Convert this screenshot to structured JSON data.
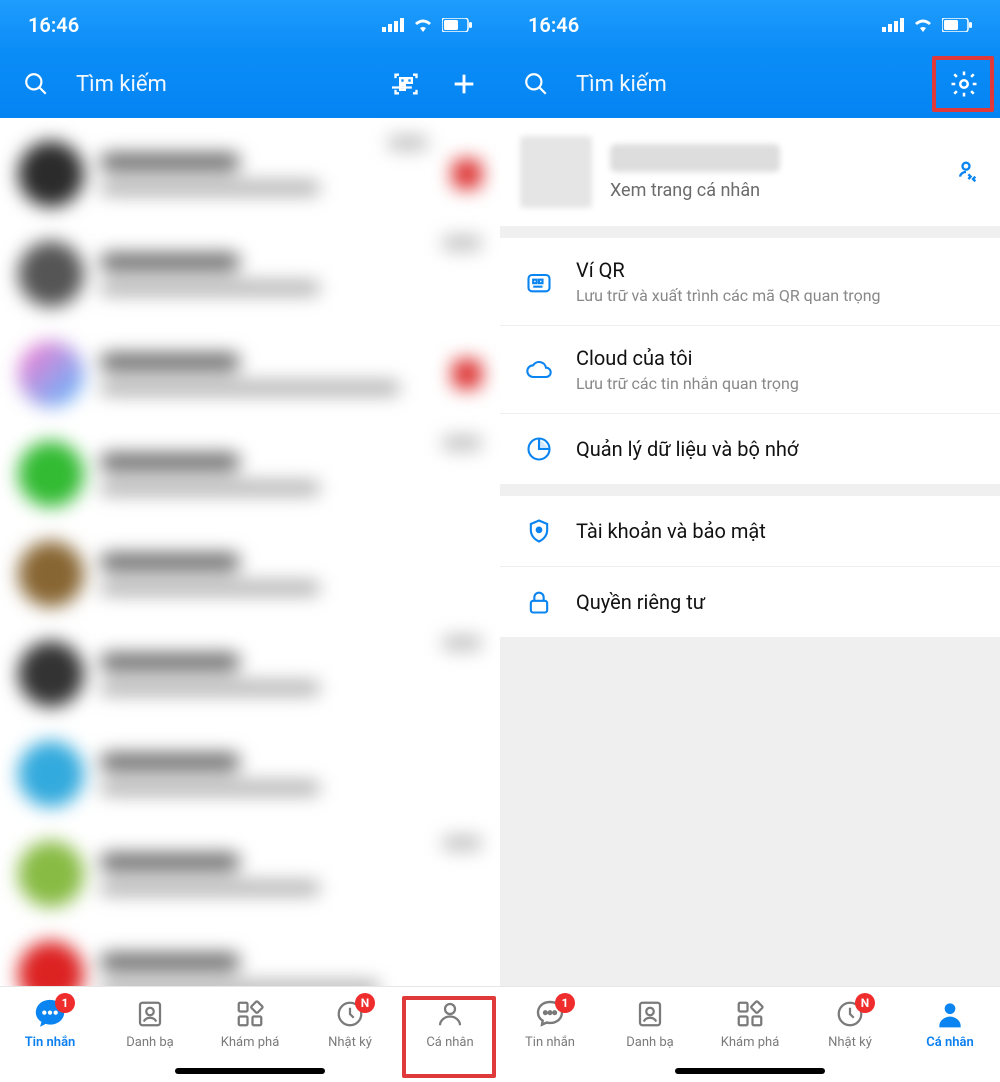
{
  "status": {
    "time": "16:46"
  },
  "header": {
    "search_placeholder": "Tìm kiếm"
  },
  "profile": {
    "view_profile": "Xem trang cá nhân"
  },
  "menu": {
    "qr_wallet": {
      "title": "Ví QR",
      "desc": "Lưu trữ và xuất trình các mã QR quan trọng"
    },
    "cloud": {
      "title": "Cloud của tôi",
      "desc": "Lưu trữ các tin nhắn quan trọng"
    },
    "storage": {
      "title": "Quản lý dữ liệu và bộ nhớ"
    },
    "security": {
      "title": "Tài khoản và bảo mật"
    },
    "privacy": {
      "title": "Quyền riêng tư"
    }
  },
  "nav": {
    "messages": "Tin nhắn",
    "contacts": "Danh bạ",
    "discover": "Khám phá",
    "diary": "Nhật ký",
    "profile": "Cá nhân",
    "messages_badge": "1",
    "diary_badge": "N"
  },
  "colors": {
    "blue": "#0a84f0",
    "header_blue": "#0b8df7",
    "red": "#e03939"
  }
}
